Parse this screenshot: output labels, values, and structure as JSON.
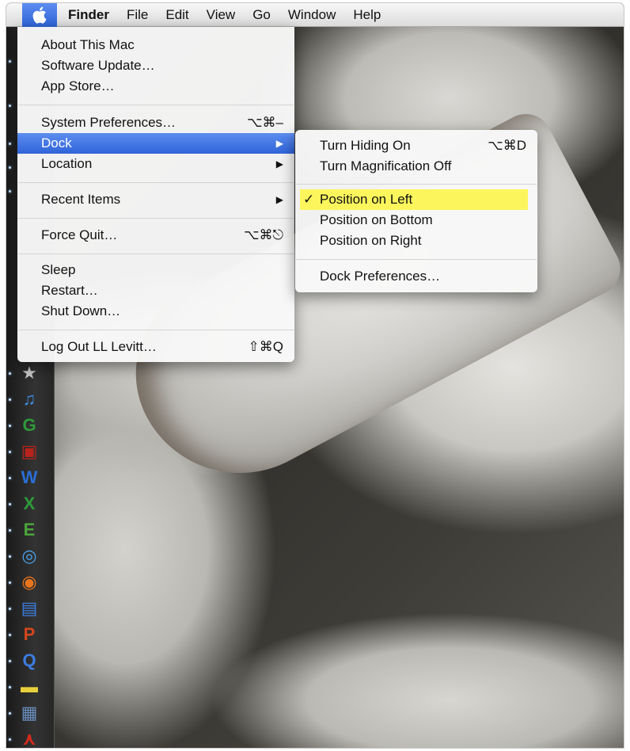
{
  "menubar": {
    "apple_icon": "apple-icon",
    "items": [
      "Finder",
      "File",
      "Edit",
      "View",
      "Go",
      "Window",
      "Help"
    ]
  },
  "apple_menu": {
    "about": "About This Mac",
    "software_update": "Software Update…",
    "app_store": "App Store…",
    "system_prefs": "System Preferences…",
    "system_prefs_shortcut": "⌥⌘–",
    "dock": "Dock",
    "location": "Location",
    "recent_items": "Recent Items",
    "force_quit": "Force Quit…",
    "force_quit_shortcut": "⌥⌘⎋",
    "sleep": "Sleep",
    "restart": "Restart…",
    "shut_down": "Shut Down…",
    "log_out": "Log Out LL Levitt…",
    "log_out_shortcut": "⇧⌘Q",
    "submenu_arrow": "▶"
  },
  "dock_submenu": {
    "hiding": "Turn Hiding On",
    "hiding_shortcut": "⌥⌘D",
    "magnification": "Turn Magnification Off",
    "checkmark": "✓",
    "position_left": "Position on Left",
    "position_bottom": "Position on Bottom",
    "position_right": "Position on Right",
    "preferences": "Dock Preferences…"
  },
  "colors": {
    "selection_blue": "#3a6fe0",
    "highlight_yellow": "#fcf65c",
    "dock_dark": "#2a2a2a"
  },
  "dock_icons": [
    {
      "name": "imovie-star-icon",
      "glyph": "★",
      "color": "#c8c8c8"
    },
    {
      "name": "itunes-icon",
      "glyph": "♫",
      "color": "#3c8ee8"
    },
    {
      "name": "garageband-icon",
      "glyph": "G",
      "color": "#2e9a3a"
    },
    {
      "name": "photo-booth-icon",
      "glyph": "▣",
      "color": "#b8241c"
    },
    {
      "name": "word-icon",
      "glyph": "W",
      "color": "#2a6fd4"
    },
    {
      "name": "excel-icon",
      "glyph": "X",
      "color": "#2e9a3a"
    },
    {
      "name": "evernote-icon",
      "glyph": "E",
      "color": "#4aa63a"
    },
    {
      "name": "safari-icon",
      "glyph": "◎",
      "color": "#4aa0e8"
    },
    {
      "name": "firefox-icon",
      "glyph": "◉",
      "color": "#e8741c"
    },
    {
      "name": "scanner-icon",
      "glyph": "▤",
      "color": "#3c7ee0"
    },
    {
      "name": "powerpoint-icon",
      "glyph": "P",
      "color": "#d4451c"
    },
    {
      "name": "quicktime-icon",
      "glyph": "Q",
      "color": "#3c7ee0"
    },
    {
      "name": "stickies-icon",
      "glyph": "▬",
      "color": "#e8d03c"
    },
    {
      "name": "preview-icon",
      "glyph": "▦",
      "color": "#6a8ec0"
    },
    {
      "name": "acrobat-icon",
      "glyph": "⋏",
      "color": "#d42a1c"
    }
  ]
}
